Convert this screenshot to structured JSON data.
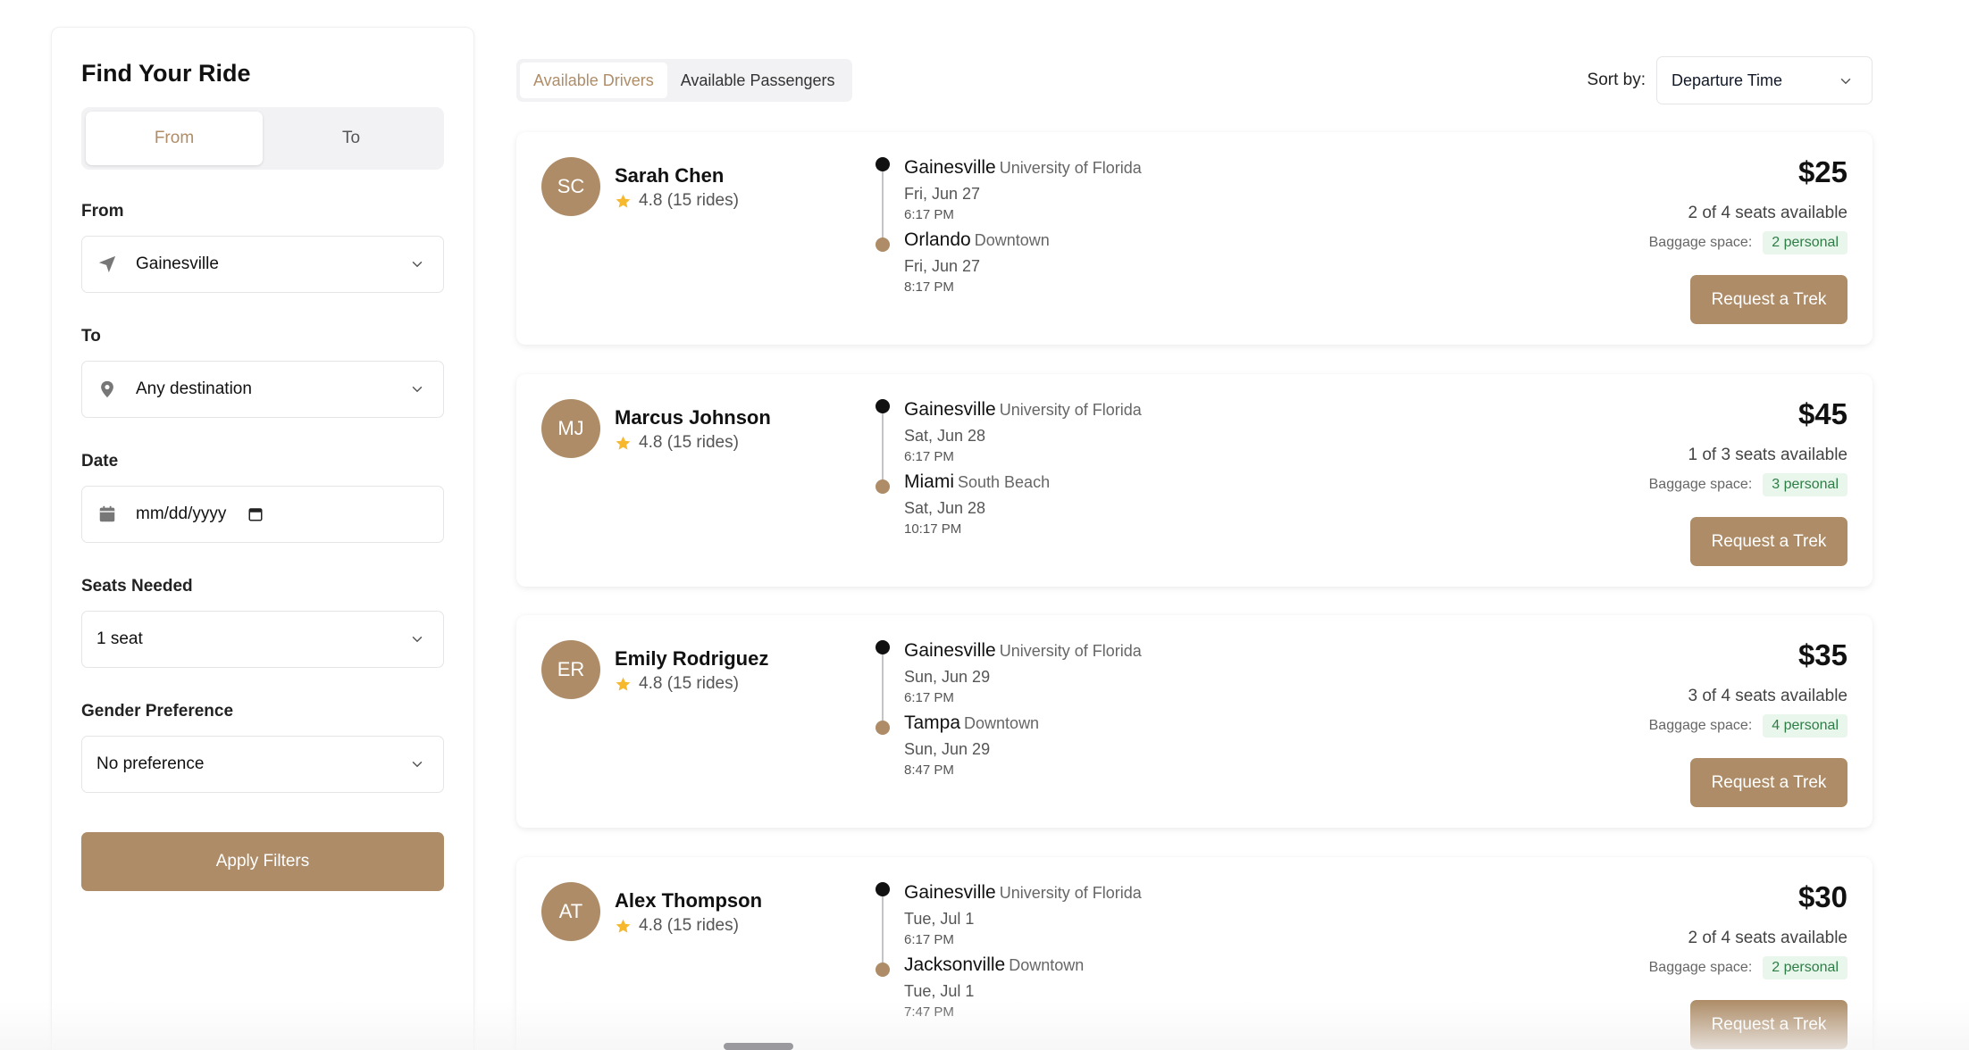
{
  "sidebar": {
    "title": "Find Your Ride",
    "toggle": {
      "from": "From",
      "to": "To",
      "active": "from"
    },
    "from_label": "From",
    "from_value": "Gainesville",
    "to_label": "To",
    "to_value": "Any destination",
    "date_label": "Date",
    "date_placeholder": "mm/dd/yyyy",
    "seats_label": "Seats Needed",
    "seats_value": "1 seat",
    "gender_label": "Gender Preference",
    "gender_value": "No preference",
    "apply_label": "Apply Filters"
  },
  "tabs": [
    "Available Drivers",
    "Available Passengers"
  ],
  "sort": {
    "label": "Sort by:",
    "value": "Departure Time"
  },
  "colors": {
    "accent": "#ad8c67",
    "badge_bg": "#e8f6ec",
    "badge_text": "#2e7d46"
  },
  "rides": [
    {
      "initials": "SC",
      "name": "Sarah Chen",
      "rating": "4.8 (15 rides)",
      "from_city": "Gainesville",
      "from_area": "University of Florida",
      "from_date": "Fri, Jun 27",
      "from_time": "6:17 PM",
      "to_city": "Orlando",
      "to_area": "Downtown",
      "to_date": "Fri, Jun 27",
      "to_time": "8:17 PM",
      "price": "$25",
      "seats": "2 of 4 seats available",
      "baggage_label": "Baggage space:",
      "baggage": "2 personal",
      "button": "Request a Trek"
    },
    {
      "initials": "MJ",
      "name": "Marcus Johnson",
      "rating": "4.8 (15 rides)",
      "from_city": "Gainesville",
      "from_area": "University of Florida",
      "from_date": "Sat, Jun 28",
      "from_time": "6:17 PM",
      "to_city": "Miami",
      "to_area": "South Beach",
      "to_date": "Sat, Jun 28",
      "to_time": "10:17 PM",
      "price": "$45",
      "seats": "1 of 3 seats available",
      "baggage_label": "Baggage space:",
      "baggage": "3 personal",
      "button": "Request a Trek"
    },
    {
      "initials": "ER",
      "name": "Emily Rodriguez",
      "rating": "4.8 (15 rides)",
      "from_city": "Gainesville",
      "from_area": "University of Florida",
      "from_date": "Sun, Jun 29",
      "from_time": "6:17 PM",
      "to_city": "Tampa",
      "to_area": "Downtown",
      "to_date": "Sun, Jun 29",
      "to_time": "8:47 PM",
      "price": "$35",
      "seats": "3 of 4 seats available",
      "baggage_label": "Baggage space:",
      "baggage": "4 personal",
      "button": "Request a Trek"
    },
    {
      "initials": "AT",
      "name": "Alex Thompson",
      "rating": "4.8 (15 rides)",
      "from_city": "Gainesville",
      "from_area": "University of Florida",
      "from_date": "Tue, Jul 1",
      "from_time": "6:17 PM",
      "to_city": "Jacksonville",
      "to_area": "Downtown",
      "to_date": "Tue, Jul 1",
      "to_time": "7:47 PM",
      "price": "$30",
      "seats": "2 of 4 seats available",
      "baggage_label": "Baggage space:",
      "baggage": "2 personal",
      "button": "Request a Trek"
    }
  ]
}
